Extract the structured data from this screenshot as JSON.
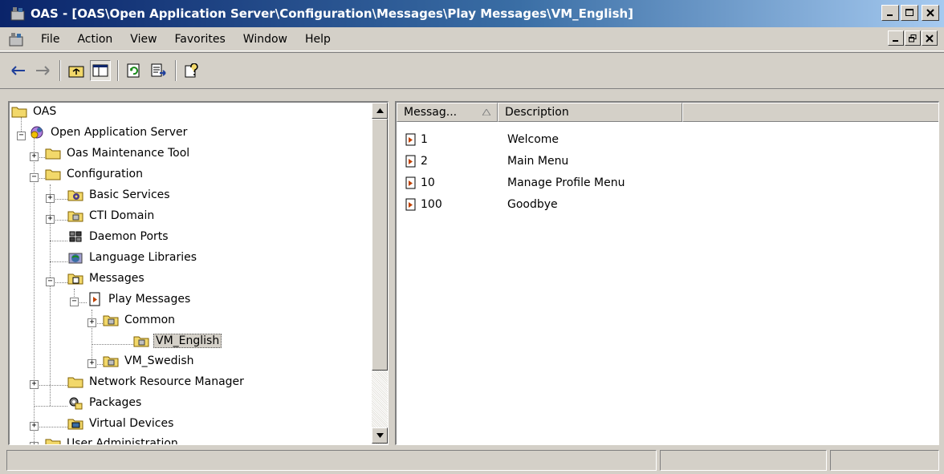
{
  "window": {
    "title": "OAS - [OAS\\Open Application Server\\Configuration\\Messages\\Play Messages\\VM_English]"
  },
  "menu": {
    "items": [
      {
        "label": "File"
      },
      {
        "label": "Action"
      },
      {
        "label": "View"
      },
      {
        "label": "Favorites"
      },
      {
        "label": "Window"
      },
      {
        "label": "Help"
      }
    ]
  },
  "tree": {
    "items": [
      {
        "label": "OAS"
      },
      {
        "label": "Open Application Server"
      },
      {
        "label": "Oas Maintenance Tool"
      },
      {
        "label": "Configuration"
      },
      {
        "label": "Basic Services"
      },
      {
        "label": "CTI Domain"
      },
      {
        "label": "Daemon Ports"
      },
      {
        "label": "Language Libraries"
      },
      {
        "label": "Messages"
      },
      {
        "label": "Play Messages"
      },
      {
        "label": "Common"
      },
      {
        "label": "VM_English"
      },
      {
        "label": "VM_Swedish"
      },
      {
        "label": "Network Resource Manager"
      },
      {
        "label": "Packages"
      },
      {
        "label": "Virtual Devices"
      },
      {
        "label": "User Administration"
      }
    ]
  },
  "list": {
    "columns": [
      {
        "label": "Messag..."
      },
      {
        "label": "Description"
      }
    ],
    "rows": [
      {
        "id": "1",
        "description": "Welcome"
      },
      {
        "id": "2",
        "description": "Main Menu"
      },
      {
        "id": "10",
        "description": "Manage Profile Menu"
      },
      {
        "id": "100",
        "description": "Goodbye"
      }
    ]
  },
  "colors": {
    "title_start": "#0a246a",
    "title_end": "#a6caf0",
    "chrome": "#d4d0c8",
    "folder": "#f2d86a"
  }
}
